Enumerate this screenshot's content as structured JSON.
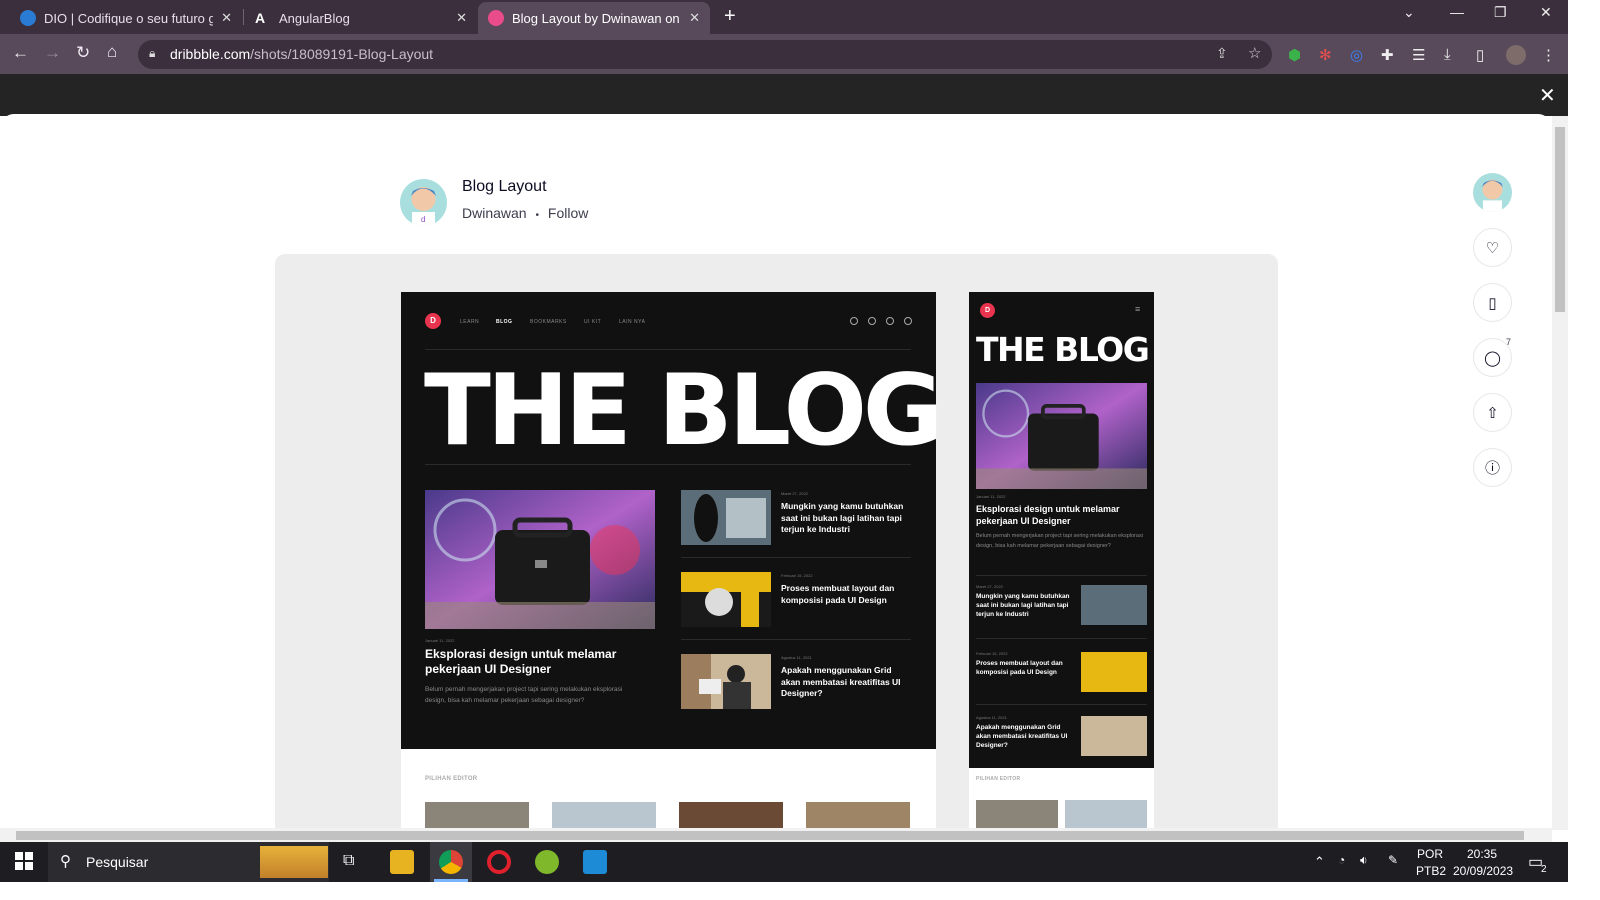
{
  "browser": {
    "tabs": [
      {
        "title": "DIO | Codifique o seu futuro glob",
        "icon": "dio-icon",
        "color": "#2a7bd3",
        "active": false
      },
      {
        "title": "AngularBlog",
        "icon": "angular-icon",
        "color": "#ffffff",
        "active": false
      },
      {
        "title": "Blog Layout by Dwinawan on Dri",
        "icon": "dribbble-icon",
        "color": "#ea4c89",
        "active": true
      }
    ],
    "new_tab": "+",
    "url_host": "dribbble.com",
    "url_path": "/shots/18089191-Blog-Layout",
    "close_overlay": "✕"
  },
  "shot": {
    "title": "Blog Layout",
    "author": "Dwinawan",
    "separator": "•",
    "follow": "Follow",
    "comment_count": "7"
  },
  "desktop": {
    "logo": "D",
    "nav": [
      "LEARN",
      "BLOG",
      "BOOKMARKS",
      "UI KIT",
      "LAIN NYA"
    ],
    "hero": "THE BLOG",
    "feature": {
      "date": "Januari 11, 2022",
      "title": "Eksplorasi design untuk melamar pekerjaan UI Designer",
      "desc": "Belum pernah mengerjakan project tapi sering melakukan eksplorasi design, bisa kah melamar pekerjaan sebagai designer?"
    },
    "posts": [
      {
        "date": "Maret 27, 2022",
        "title": "Mungkin yang kamu butuhkan saat ini bukan lagi latihan tapi terjun ke Industri"
      },
      {
        "date": "Februari 15, 2022",
        "title": "Proses membuat layout dan komposisi pada UI Design"
      },
      {
        "date": "Agustus 11, 2021",
        "title": "Apakah menggunakan Grid akan membatasi kreatifitas UI Designer?"
      }
    ],
    "editor_label": "PILIHAN EDITOR"
  },
  "mobile": {
    "logo": "D",
    "menu": "≡",
    "hero": "THE BLOG",
    "feature": {
      "date": "Januari 11, 2022",
      "title": "Eksplorasi design untuk melamar pekerjaan UI Designer",
      "desc": "Belum pernah mengerjakan project tapi sering melakukan eksplorasi design, bisa kah melamar pekerjaan sebagai designer?"
    },
    "posts": [
      {
        "date": "Maret 27, 2022",
        "title": "Mungkin yang kamu butuhkan saat ini bukan lagi latihan tapi terjun ke Industri"
      },
      {
        "date": "Februari 15, 2022",
        "title": "Proses membuat layout dan komposisi pada UI Design"
      },
      {
        "date": "Agustus 11, 2021",
        "title": "Apakah menggunakan Grid akan membatasi kreatifitas UI Designer?"
      }
    ],
    "editor_label": "PILIHAN EDITOR"
  },
  "taskbar": {
    "search_placeholder": "Pesquisar",
    "lang": "POR",
    "layout": "PTB2",
    "time": "20:35",
    "date": "20/09/2023",
    "notifications": "2"
  }
}
